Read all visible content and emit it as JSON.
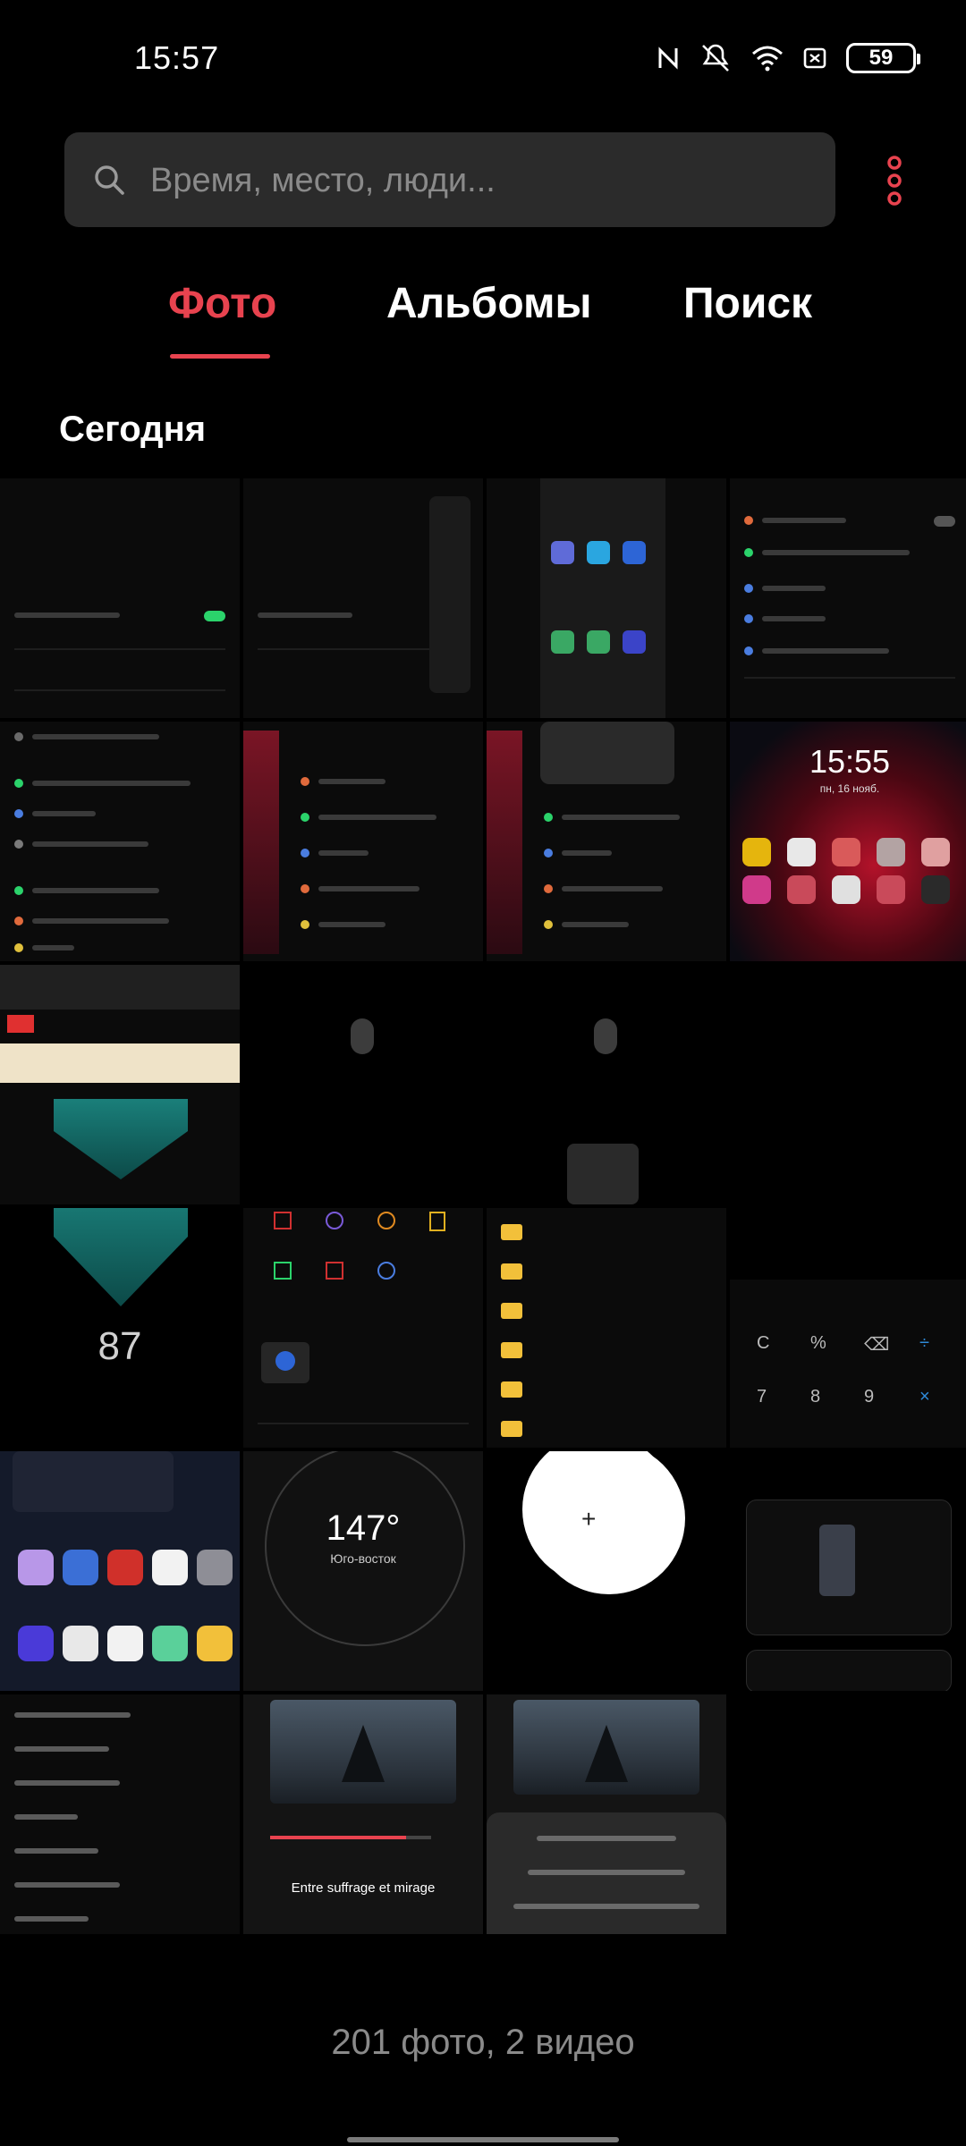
{
  "status_bar": {
    "time": "15:57",
    "battery": "59",
    "icons": [
      "nfc-icon",
      "mute-icon",
      "wifi-icon",
      "sim-icon",
      "battery-icon"
    ]
  },
  "search": {
    "placeholder": "Время, место, люди..."
  },
  "tabs": [
    {
      "label": "Фото",
      "active": true
    },
    {
      "label": "Альбомы",
      "active": false
    },
    {
      "label": "Поиск",
      "active": false
    }
  ],
  "section": {
    "title": "Сегодня"
  },
  "thumbnails": {
    "t4_clock": "15:55",
    "t4_date": "пн, 16 нояб.",
    "t9_number": "87",
    "t18_degrees": "147°",
    "t18_direction": "Юго-восток",
    "t22_title": "Entre suffrage et mirage"
  },
  "footer": {
    "count_text": "201 фото, 2 видео"
  },
  "colors": {
    "accent": "#e8434f",
    "background": "#000000",
    "search_bg": "#2b2b2b"
  }
}
